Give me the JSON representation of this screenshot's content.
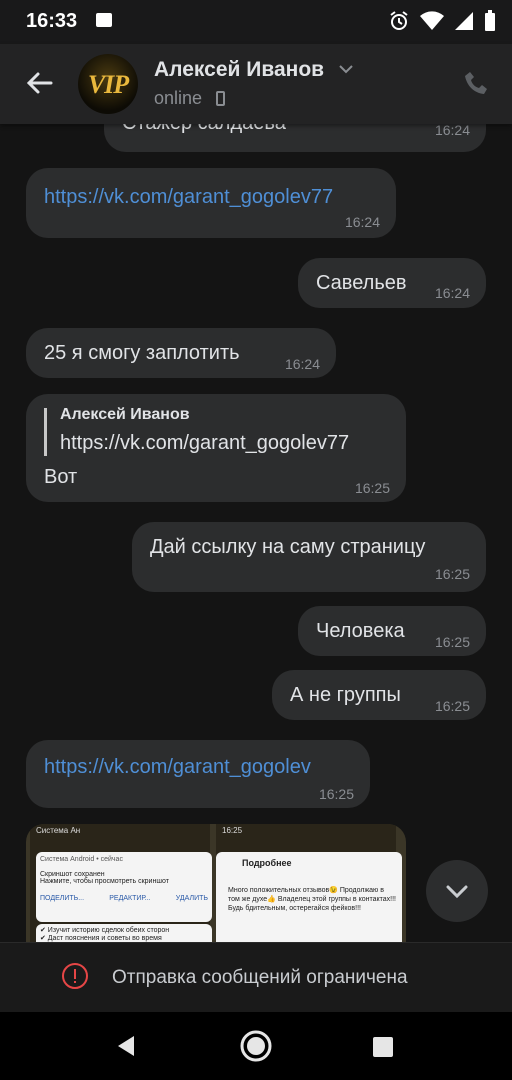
{
  "status": {
    "time": "16:33"
  },
  "header": {
    "name": "Алексей Иванов",
    "presence": "online",
    "avatar_text": "VIP"
  },
  "messages": {
    "m0": {
      "text": "Стажер салдаева",
      "time": "16:24"
    },
    "m1": {
      "text": "https://vk.com/garant_gogolev77",
      "time": "16:24"
    },
    "m2": {
      "text": "Савельев",
      "time": "16:24"
    },
    "m3": {
      "text": "25 я смогу заплотить",
      "time": "16:24"
    },
    "m4": {
      "reply_author": "Алексей Иванов",
      "reply_text": "https://vk.com/garant_gogolev77",
      "text": "Вот",
      "time": "16:25"
    },
    "m5": {
      "text": "Дай ссылку на саму страницу",
      "time": "16:25"
    },
    "m6": {
      "text": "Человека",
      "time": "16:25"
    },
    "m7": {
      "text": "А не группы",
      "time": "16:25"
    },
    "m8": {
      "text": "https://vk.com/garant_gogolev",
      "time": "16:25"
    }
  },
  "attachment": {
    "left_status": "Система Ан",
    "left_notif_title": "Система Android • сейчас",
    "left_notif_line1": "Скриншот сохранен",
    "left_notif_line2": "Нажмите, чтобы просмотреть скриншот",
    "left_actions": [
      "ПОДЕЛИТЬ...",
      "РЕДАКТИР...",
      "УДАЛИТЬ"
    ],
    "left_lines": [
      "✔ Изучит историю сделок обеих сторон",
      "✔ Даст пояснения и советы во время"
    ],
    "right_status": "16:25",
    "right_title": "Подробнее",
    "right_text": "Много положительных отзывов😉 Продолжаю в том же духе👍 Владелец этой группы в контактах!!! Будь бдительным, остерегайся фейков!!!"
  },
  "bottom": {
    "restriction": "Отправка сообщений ограничена"
  },
  "colors": {
    "link": "#4f8fd6",
    "bubble": "#2c2d2e",
    "warning": "#e64646"
  }
}
